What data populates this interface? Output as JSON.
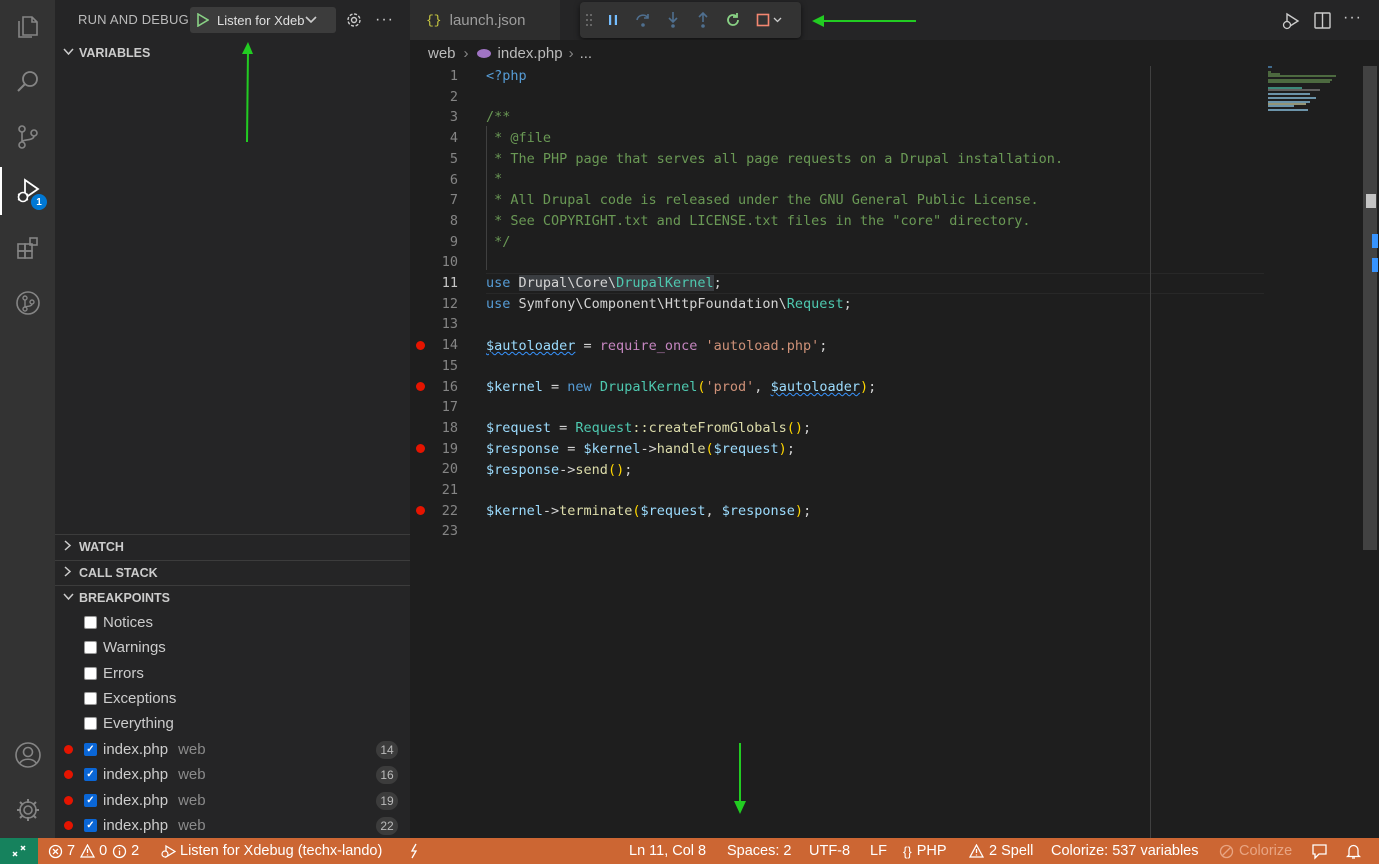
{
  "sidebar": {
    "title": "RUN AND DEBUG",
    "launch_config": "Listen for Xdebug",
    "sections": {
      "variables": "VARIABLES",
      "watch": "WATCH",
      "call_stack": "CALL STACK",
      "breakpoints": "BREAKPOINTS"
    },
    "exception_breakpoints": [
      "Notices",
      "Warnings",
      "Errors",
      "Exceptions",
      "Everything"
    ],
    "file_breakpoints": [
      {
        "file": "index.php",
        "folder": "web",
        "line": "14"
      },
      {
        "file": "index.php",
        "folder": "web",
        "line": "16"
      },
      {
        "file": "index.php",
        "folder": "web",
        "line": "19"
      },
      {
        "file": "index.php",
        "folder": "web",
        "line": "22"
      }
    ],
    "debug_badge": "1"
  },
  "tabs": {
    "launch": {
      "icon": "{}",
      "name": "launch.json"
    }
  },
  "breadcrumb": {
    "folder": "web",
    "file": "index.php",
    "more": "..."
  },
  "code": {
    "line_numbers": [
      "1",
      "2",
      "3",
      "4",
      "5",
      "6",
      "7",
      "8",
      "9",
      "10",
      "11",
      "12",
      "13",
      "14",
      "15",
      "16",
      "17",
      "18",
      "19",
      "20",
      "21",
      "22",
      "23"
    ],
    "current_line": "11",
    "l1": "<?php",
    "l3": "/**",
    "l4": " * @file",
    "l5": " * The PHP page that serves all page requests on a Drupal installation.",
    "l6": " *",
    "l7": " * All Drupal code is released under the GNU General Public License.",
    "l8": " * See COPYRIGHT.txt and LICENSE.txt files in the \"core\" directory.",
    "l9": " */",
    "use": "use",
    "l11_ns": "Drupal\\Core\\",
    "l11_cls": "DrupalKernel",
    "semi": ";",
    "l12_ns": "Symfony\\Component\\HttpFoundation\\",
    "l12_cls": "Request",
    "autoloader": "$autoloader",
    "eq": " = ",
    "require_once": "require_once",
    "autoload_str": "'autoload.php'",
    "kernel": "$kernel",
    "new": "new",
    "drupalkernel": "DrupalKernel",
    "prod": "'prod'",
    "comma": ", ",
    "request": "$request",
    "request_cls": "Request",
    "create": "::createFromGlobals",
    "response": "$response",
    "arrow": "->",
    "handle": "handle",
    "send": "send",
    "terminate": "terminate"
  },
  "status": {
    "errors": "7",
    "warnings": "0",
    "infos": "2",
    "debug_session": "Listen for Xdebug (techx-lando)",
    "position": "Ln 11, Col 8",
    "spaces": "Spaces: 2",
    "encoding": "UTF-8",
    "eol": "LF",
    "language": "PHP",
    "spell": "2 Spell",
    "colorize": "Colorize: 537 variables",
    "colorize_btn": "Colorize"
  },
  "colors": {
    "status_bar": "#cc6633",
    "breakpoint": "#e51400",
    "annotation_arrow": "#22cc22",
    "accent": "#0078d4"
  }
}
